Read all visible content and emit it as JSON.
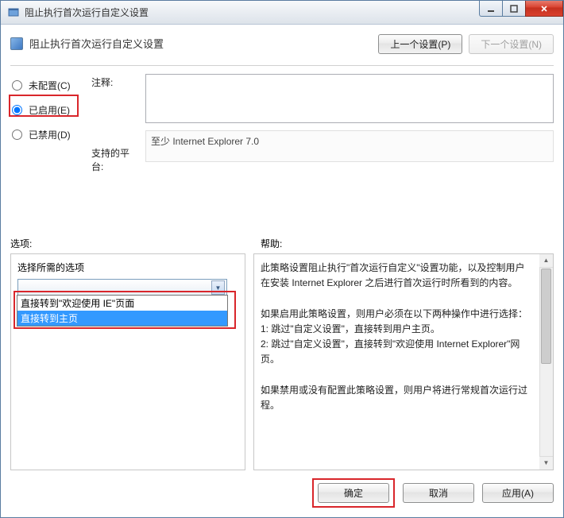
{
  "window": {
    "title": "阻止执行首次运行自定义设置"
  },
  "header": {
    "title": "阻止执行首次运行自定义设置",
    "prev_label": "上一个设置(P)",
    "next_label": "下一个设置(N)"
  },
  "radios": {
    "not_configured": "未配置(C)",
    "enabled": "已启用(E)",
    "disabled": "已禁用(D)",
    "selected": "enabled"
  },
  "labels": {
    "comment": "注释:",
    "supported": "支持的平台:",
    "options": "选项:",
    "help": "帮助:",
    "option_prompt": "选择所需的选项"
  },
  "supported_text": "至少 Internet Explorer 7.0",
  "dropdown": {
    "options": [
      "直接转到\"欢迎使用 IE\"页面",
      "直接转到主页"
    ],
    "selected_index": 1
  },
  "help_text": "此策略设置阻止执行\"首次运行自定义\"设置功能，以及控制用户在安装 Internet Explorer 之后进行首次运行时所看到的内容。\n\n如果启用此策略设置，则用户必须在以下两种操作中进行选择：\n1: 跳过\"自定义设置\"，直接转到用户主页。\n2: 跳过\"自定义设置\"，直接转到\"欢迎使用 Internet Explorer\"网页。\n\n如果禁用或没有配置此策略设置，则用户将进行常规首次运行过程。",
  "footer": {
    "ok": "确定",
    "cancel": "取消",
    "apply": "应用(A)"
  }
}
